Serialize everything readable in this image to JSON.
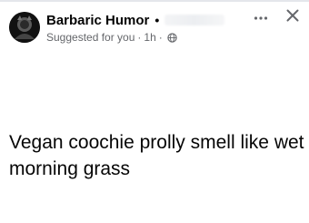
{
  "post": {
    "author_name": "Barbaric Humor",
    "name_separator": "•",
    "suggested_label": "Suggested for you",
    "meta_separator_1": "·",
    "time_label": "1h",
    "meta_separator_2": "·",
    "audience_icon": "globe-icon",
    "body_text": "Vegan coochie prolly smell like wet morning grass"
  },
  "header_actions": {
    "more_icon": "more-horizontal-icon",
    "close_icon": "close-icon"
  },
  "colors": {
    "text_primary": "#050505",
    "text_secondary": "#65676b",
    "divider": "#e4e6eb"
  }
}
